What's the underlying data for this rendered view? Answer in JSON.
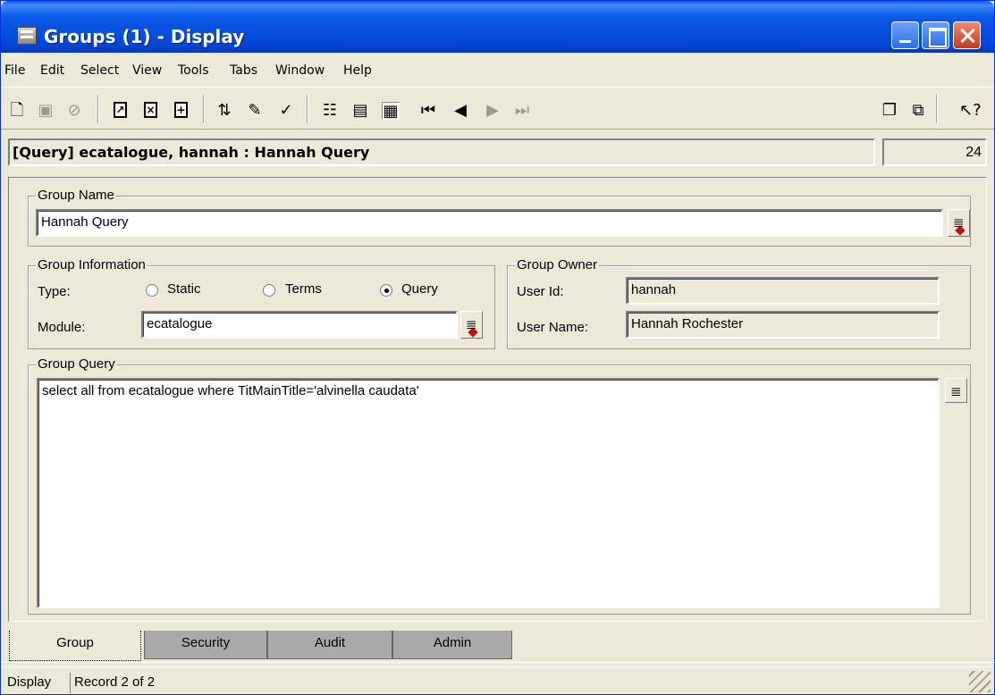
{
  "window": {
    "title": "Groups (1) - Display"
  },
  "menu": [
    "File",
    "Edit",
    "Select",
    "View",
    "Tools",
    "Tabs",
    "Window",
    "Help"
  ],
  "status": {
    "query_line": "[Query] ecatalogue,  hannah : Hannah Query",
    "count": "24"
  },
  "group_name": {
    "legend": "Group Name",
    "value": "Hannah Query"
  },
  "group_information": {
    "legend": "Group Information",
    "type_label": "Type:",
    "types": [
      "Static",
      "Terms",
      "Query"
    ],
    "selected_type": "Query",
    "module_label": "Module:",
    "module_value": "ecatalogue"
  },
  "group_owner": {
    "legend": "Group Owner",
    "user_id_label": "User Id:",
    "user_id": "hannah",
    "user_name_label": "User Name:",
    "user_name": "Hannah Rochester"
  },
  "group_query": {
    "legend": "Group Query",
    "value": "select all from ecatalogue where TitMainTitle='alvinella caudata'"
  },
  "tabs": [
    "Group",
    "Security",
    "Audit",
    "Admin"
  ],
  "bottom_status": {
    "mode": "Display",
    "record": "Record 2 of 2"
  }
}
